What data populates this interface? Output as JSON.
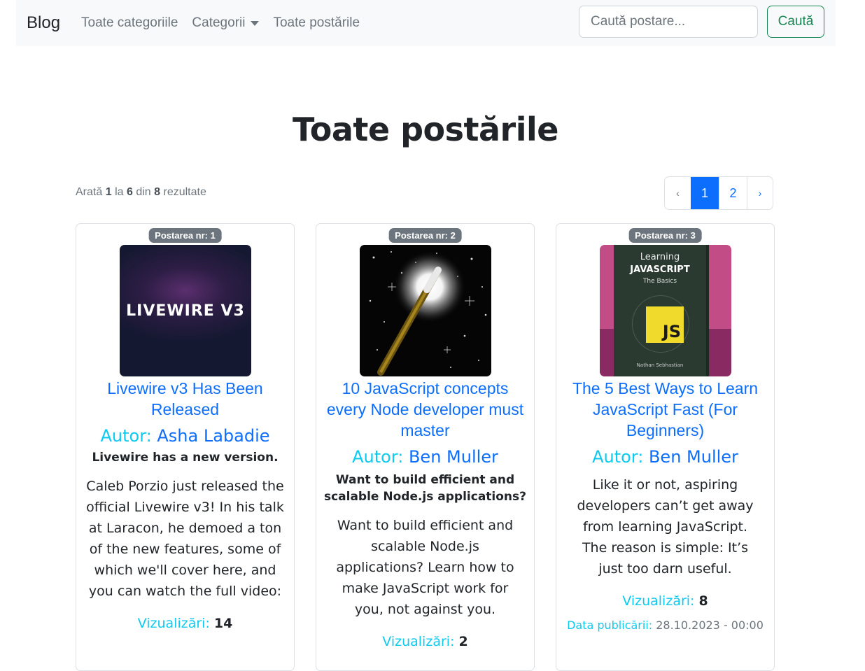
{
  "navbar": {
    "brand": "Blog",
    "links": [
      "Toate categoriile",
      "Categorii",
      "Toate postările"
    ],
    "search_placeholder": "Caută postare...",
    "search_button": "Caută"
  },
  "page_title": "Toate postările",
  "results": {
    "prefix": "Arată",
    "from": "1",
    "la": "la",
    "to": "6",
    "din": "din",
    "total": "8",
    "suffix": "rezultate"
  },
  "pagination": {
    "prev": "‹",
    "pages": [
      "1",
      "2"
    ],
    "next": "›",
    "active": "1"
  },
  "posts": [
    {
      "badge": "Postarea nr: 1",
      "image_text": "LIVEWIRE V3",
      "title": "Livewire v3 Has Been Released",
      "author_label": "Autor:",
      "author": "Asha Labadie",
      "subtitle": "Livewire has a new version.",
      "description": "Caleb Porzio just released the official Livewire v3! In his talk at Laracon, he demoed a ton of the new features, some of which we'll cover here, and you can watch the full video:",
      "views_label": "Vizualizări:",
      "views": "14"
    },
    {
      "badge": "Postarea nr: 2",
      "title": "10 JavaScript concepts every Node developer must master",
      "author_label": "Autor:",
      "author": "Ben Muller",
      "subtitle": "Want to build efficient and scalable Node.js applications?",
      "description": "Want to build efficient and scalable Node.js applications? Learn how to make JavaScript work for you, not against you.",
      "views_label": "Vizualizări:",
      "views": "2"
    },
    {
      "badge": "Postarea nr: 3",
      "image_text": {
        "line1": "Learning",
        "line2": "JAVASCRIPT",
        "line3": "The Basics",
        "logo": "JS",
        "author": "Nathan Sebhastian"
      },
      "title": "The 5 Best Ways to Learn JavaScript Fast (For Beginners)",
      "author_label": "Autor:",
      "author": "Ben Muller",
      "description": "Like it or not, aspiring developers can’t get away from learning JavaScript. The reason is simple: It’s just too darn useful.",
      "views_label": "Vizualizări:",
      "views": "8",
      "date_label": "Data publicării:",
      "date": "28.10.2023 - 00:00"
    }
  ],
  "colors": {
    "primary": "#0d6efd",
    "info": "#0dcaf0",
    "success": "#198754",
    "secondary": "#6c757d"
  }
}
